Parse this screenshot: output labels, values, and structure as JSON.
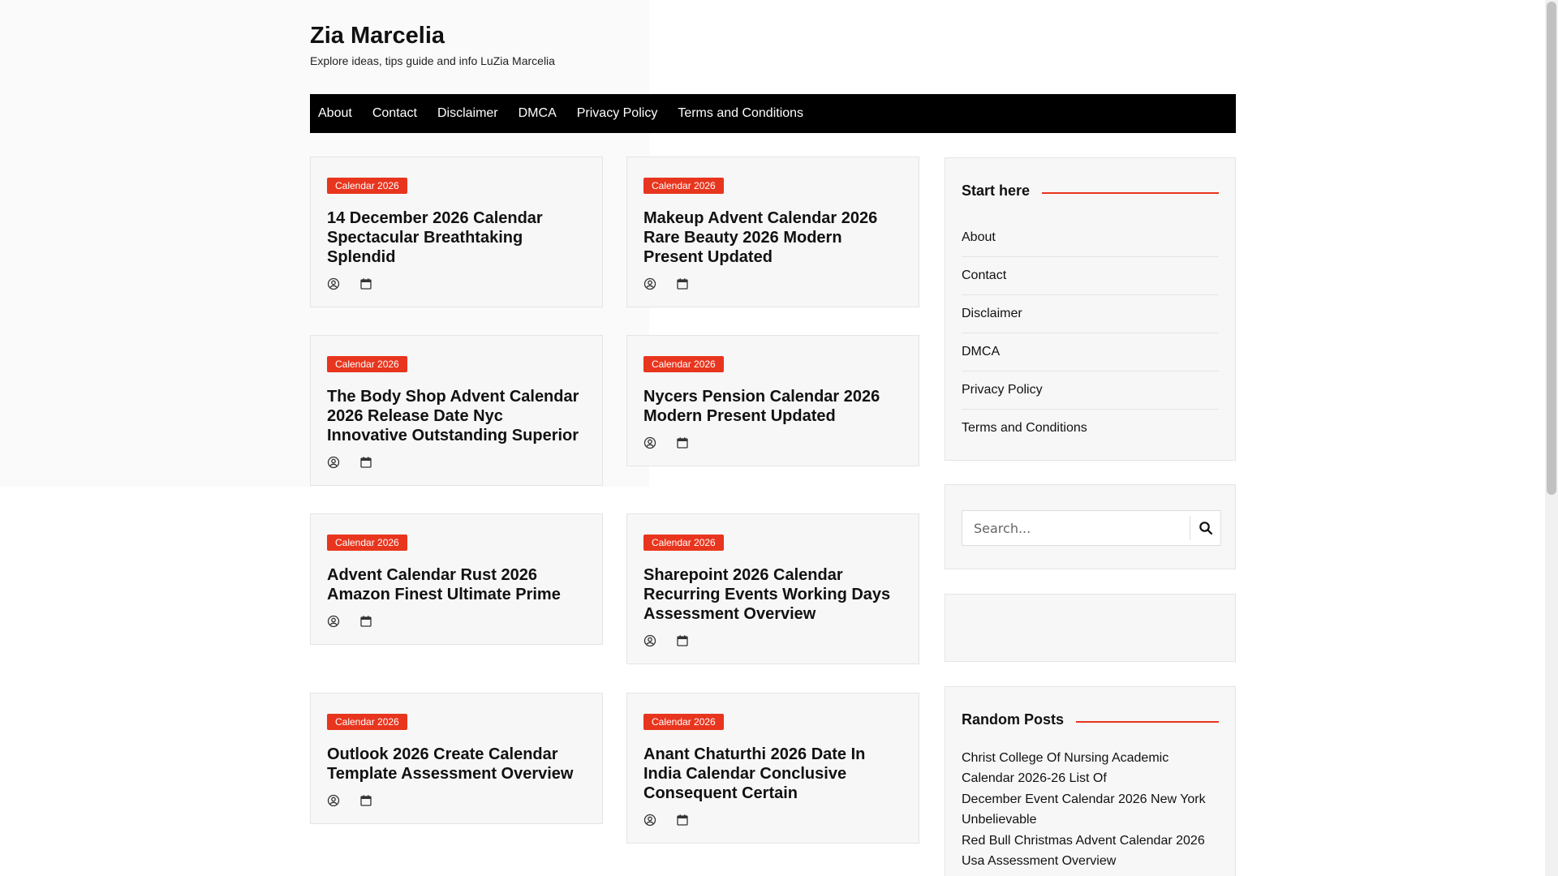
{
  "site": {
    "title": "Zia Marcelia",
    "tagline": "Explore ideas, tips guide and info LuZia Marcelia"
  },
  "nav": [
    "About",
    "Contact",
    "Disclaimer",
    "DMCA",
    "Privacy Policy",
    "Terms and Conditions"
  ],
  "posts": [
    {
      "category": "Calendar 2026",
      "title": "14 December 2026 Calendar Spectacular Breathtaking Splendid"
    },
    {
      "category": "Calendar 2026",
      "title": "Makeup Advent Calendar 2026 Rare Beauty 2026 Modern Present Updated"
    },
    {
      "category": "Calendar 2026",
      "title": "The Body Shop Advent Calendar 2026 Release Date Nyc Innovative Outstanding Superior"
    },
    {
      "category": "Calendar 2026",
      "title": "Nycers Pension Calendar 2026 Modern Present Updated"
    },
    {
      "category": "Calendar 2026",
      "title": "Advent Calendar Rust 2026 Amazon Finest Ultimate Prime"
    },
    {
      "category": "Calendar 2026",
      "title": "Sharepoint 2026 Calendar Recurring Events Working Days Assessment Overview"
    },
    {
      "category": "Calendar 2026",
      "title": "Outlook 2026 Create Calendar Template Assessment Overview"
    },
    {
      "category": "Calendar 2026",
      "title": "Anant Chaturthi 2026 Date In India Calendar Conclusive Consequent Certain"
    }
  ],
  "sidebar": {
    "start_heading": "Start here",
    "start_links": [
      "About",
      "Contact",
      "Disclaimer",
      "DMCA",
      "Privacy Policy",
      "Terms and Conditions"
    ],
    "search_placeholder": "Search...",
    "random_heading": "Random Posts",
    "random_posts": [
      "Christ College Of Nursing Academic Calendar 2026-26 List Of",
      "December Event Calendar 2026 New York Unbelievable",
      "Red Bull Christmas Advent Calendar 2026 Usa Assessment Overview"
    ]
  },
  "colors": {
    "accent": "#e8351e",
    "navbar": "#000000",
    "card_bg": "#f7f7f7"
  },
  "icons": {
    "author": "user-circle-icon",
    "date": "calendar-icon",
    "search": "search-icon"
  }
}
